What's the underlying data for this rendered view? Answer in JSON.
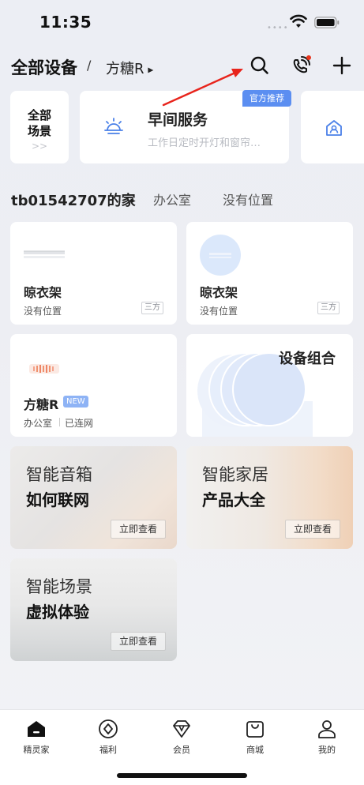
{
  "status_bar": {
    "time": "11:35",
    "dots": "••••"
  },
  "header": {
    "title": "全部设备",
    "slash": "/",
    "device": "方糖R",
    "device_arrow": "▲"
  },
  "scenes": {
    "all_scenes_line1": "全部",
    "all_scenes_line2": "场景",
    "all_scenes_chevron": ">>",
    "service": {
      "name": "早间服务",
      "desc": "工作日定时开灯和窗帘…",
      "badge": "官方推荐"
    }
  },
  "rooms": {
    "current": "tb01542707的家",
    "current_arrow": "▲",
    "tabs": [
      "办公室",
      "没有位置"
    ]
  },
  "devices": [
    {
      "name": "晾衣架",
      "location": "没有位置",
      "tag": "三方"
    },
    {
      "name": "晾衣架",
      "location": "没有位置",
      "tag": "三方"
    },
    {
      "name": "方糖R",
      "tag": "NEW",
      "location": "办公室",
      "status": "已连网"
    },
    {
      "name": "设备组合"
    }
  ],
  "promos": [
    {
      "line1": "智能音箱",
      "line2": "如何联网",
      "button": "立即查看"
    },
    {
      "line1": "智能家居",
      "line2": "产品大全",
      "button": "立即查看"
    },
    {
      "line1": "智能场景",
      "line2": "虚拟体验",
      "button": "立即查看"
    }
  ],
  "tabbar": [
    {
      "label": "精灵家",
      "icon": "home-icon",
      "active": true
    },
    {
      "label": "福利",
      "icon": "gift-diamond-icon"
    },
    {
      "label": "会员",
      "icon": "diamond-icon"
    },
    {
      "label": "商城",
      "icon": "shopping-bag-icon"
    },
    {
      "label": "我的",
      "icon": "profile-icon"
    }
  ],
  "colors": {
    "accent_blue": "#5b8ef1",
    "annotation_red": "#e8241c"
  }
}
